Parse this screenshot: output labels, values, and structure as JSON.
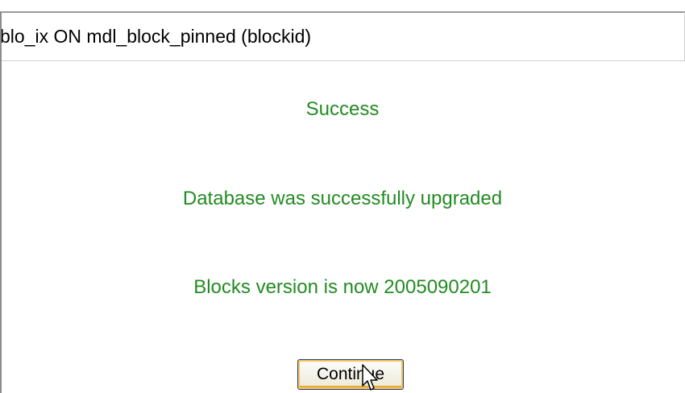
{
  "sql_statement": "blo_ix ON mdl_block_pinned (blockid)",
  "messages": {
    "success": "Success",
    "database_upgraded": "Database was successfully upgraded",
    "blocks_version": "Blocks version is now 2005090201"
  },
  "continue_button": {
    "label": "Continue"
  },
  "colors": {
    "success_text": "#228b22",
    "button_highlight": "#f5c45a"
  },
  "icons": {
    "cursor": "mouse-pointer-icon"
  }
}
